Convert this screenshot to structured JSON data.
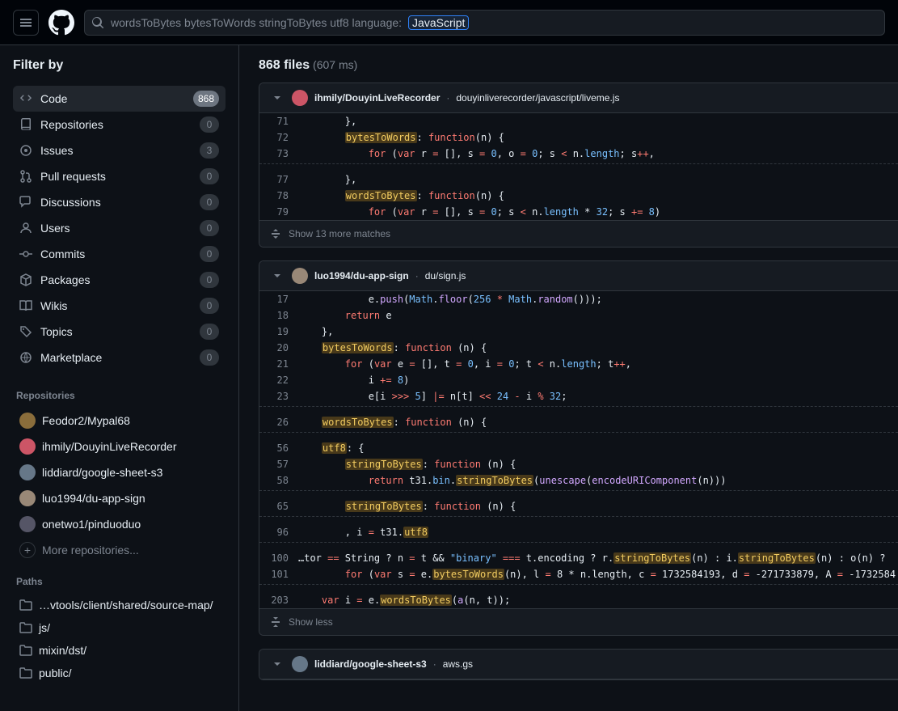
{
  "search": {
    "query": "wordsToBytes bytesToWords stringToBytes utf8 language:",
    "lang_token": "JavaScript"
  },
  "sidebar": {
    "filter_title": "Filter by",
    "types": [
      {
        "label": "Code",
        "count": "868",
        "active": true
      },
      {
        "label": "Repositories",
        "count": "0",
        "active": false
      },
      {
        "label": "Issues",
        "count": "3",
        "active": false
      },
      {
        "label": "Pull requests",
        "count": "0",
        "active": false
      },
      {
        "label": "Discussions",
        "count": "0",
        "active": false
      },
      {
        "label": "Users",
        "count": "0",
        "active": false
      },
      {
        "label": "Commits",
        "count": "0",
        "active": false
      },
      {
        "label": "Packages",
        "count": "0",
        "active": false
      },
      {
        "label": "Wikis",
        "count": "0",
        "active": false
      },
      {
        "label": "Topics",
        "count": "0",
        "active": false
      },
      {
        "label": "Marketplace",
        "count": "0",
        "active": false
      }
    ],
    "repos_title": "Repositories",
    "repos": [
      {
        "label": "Feodor2/Mypal68"
      },
      {
        "label": "ihmily/DouyinLiveRecorder"
      },
      {
        "label": "liddiard/google-sheet-s3"
      },
      {
        "label": "luo1994/du-app-sign"
      },
      {
        "label": "onetwo1/pinduoduo"
      }
    ],
    "more_repos": "More repositories...",
    "paths_title": "Paths",
    "paths": [
      {
        "label": "…vtools/client/shared/source-map/"
      },
      {
        "label": "js/"
      },
      {
        "label": "mixin/dst/"
      },
      {
        "label": "public/"
      }
    ]
  },
  "results": {
    "count": "868 files",
    "timing": "(607 ms)",
    "items": [
      {
        "repo": "ihmily/DouyinLiveRecorder",
        "file": "douyinliverecorder/javascript/liveme.js",
        "show_more": "Show 13 more matches",
        "lines": {
          "71": "},",
          "72_a": "bytesToWords",
          "72_b": ": ",
          "72_c": "function",
          "72_d": "(n) {",
          "73_a": "for",
          "73_b": " (",
          "73_c": "var",
          "73_d": " r ",
          "73_e": "=",
          "73_f": " [], s ",
          "73_g": "=",
          "73_h": " ",
          "73_i": "0",
          "73_j": ", o ",
          "73_k": "=",
          "73_l": " ",
          "73_m": "0",
          "73_n": "; s ",
          "73_o": "<",
          "73_p": " n.",
          "73_q": "length",
          "73_r": "; s",
          "73_s": "++",
          "73_t": ",",
          "77": "},",
          "78_a": "wordsToBytes",
          "78_b": ": ",
          "78_c": "function",
          "78_d": "(n) {",
          "79_a": "for",
          "79_b": " (",
          "79_c": "var",
          "79_d": " r ",
          "79_e": "=",
          "79_f": " [], s ",
          "79_g": "=",
          "79_h": " ",
          "79_i": "0",
          "79_j": "; s ",
          "79_k": "<",
          "79_l": " n.",
          "79_m": "length",
          "79_n": " * ",
          "79_o": "32",
          "79_p": "; s ",
          "79_q": "+=",
          "79_r": " ",
          "79_s": "8",
          "79_t": ")"
        }
      },
      {
        "repo": "luo1994/du-app-sign",
        "file": "du/sign.js",
        "show_less": "Show less",
        "lines": {
          "17_a": "e.",
          "17_b": "push",
          "17_c": "(",
          "17_d": "Math",
          "17_e": ".",
          "17_f": "floor",
          "17_g": "(",
          "17_h": "256",
          "17_i": " * ",
          "17_j": "Math",
          "17_k": ".",
          "17_l": "random",
          "17_m": "()));",
          "18_a": "return",
          "18_b": " e",
          "19": "},",
          "20_a": "bytesToWords",
          "20_b": ": ",
          "20_c": "function",
          "20_d": " (n) {",
          "21_a": "for",
          "21_b": " (",
          "21_c": "var",
          "21_d": " e ",
          "21_e": "=",
          "21_f": " [], t ",
          "21_g": "=",
          "21_h": " ",
          "21_i": "0",
          "21_j": ", i ",
          "21_k": "=",
          "21_l": " ",
          "21_m": "0",
          "21_n": "; t ",
          "21_o": "<",
          "21_p": " n.",
          "21_q": "length",
          "21_r": "; t",
          "21_s": "++",
          "21_t": ",",
          "22_a": "i ",
          "22_b": "+=",
          "22_c": " ",
          "22_d": "8",
          "22_e": ")",
          "23_a": "e[i ",
          "23_b": ">>>",
          "23_c": " ",
          "23_d": "5",
          "23_e": "] ",
          "23_f": "|=",
          "23_g": " n[t] ",
          "23_h": "<<",
          "23_i": " ",
          "23_j": "24",
          "23_k": " ",
          "23_l": "-",
          "23_m": " i ",
          "23_n": "%",
          "23_o": " ",
          "23_p": "32",
          "23_q": ";",
          "26_a": "wordsToBytes",
          "26_b": ": ",
          "26_c": "function",
          "26_d": " (n) {",
          "56_a": "utf8",
          "56_b": ": {",
          "57_a": "stringToBytes",
          "57_b": ": ",
          "57_c": "function",
          "57_d": " (n) {",
          "58_a": "return",
          "58_b": " t31.",
          "58_c": "bin",
          "58_d": ".",
          "58_e": "stringToBytes",
          "58_f": "(",
          "58_g": "unescape",
          "58_h": "(",
          "58_i": "encodeURIComponent",
          "58_j": "(n)))",
          "65_a": "stringToBytes",
          "65_b": ": ",
          "65_c": "function",
          "65_d": " (n) {",
          "96_a": ", i ",
          "96_b": "=",
          "96_c": " t31.",
          "96_d": "utf8",
          "100_a": "…tor ",
          "100_b": "==",
          "100_c": " String ? n ",
          "100_d": "=",
          "100_e": " t && ",
          "100_f": "\"binary\"",
          "100_g": " ",
          "100_h": "===",
          "100_i": " t.encoding ? r.",
          "100_j": "stringToBytes",
          "100_k": "(n) : i.",
          "100_l": "stringToBytes",
          "100_m": "(n) : o(n) ? ",
          "101_a": "for",
          "101_b": " (",
          "101_c": "var",
          "101_d": " s ",
          "101_e": "=",
          "101_f": " e.",
          "101_g": "bytesToWords",
          "101_h": "(n), l ",
          "101_i": "=",
          "101_j": " 8 * n.length, c ",
          "101_k": "=",
          "101_l": " 1732584193, d ",
          "101_m": "=",
          "101_n": " -271733879, A ",
          "101_o": "=",
          "101_p": " -1732584",
          "203_a": "var",
          "203_b": " i ",
          "203_c": "=",
          "203_d": " e.",
          "203_e": "wordsToBytes",
          "203_f": "(",
          "203_g": "a",
          "203_h": "(n, t));"
        }
      },
      {
        "repo": "liddiard/google-sheet-s3",
        "file": "aws.gs"
      }
    ]
  }
}
